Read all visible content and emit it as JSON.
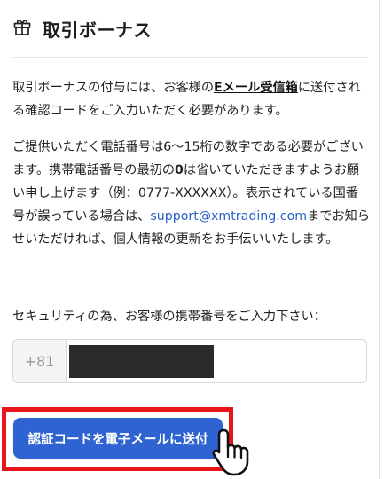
{
  "header": {
    "title": "取引ボーナス",
    "icon": "gift-icon"
  },
  "intro": {
    "text_before": "取引ボーナスの付与には、お客様の",
    "email_inbox": "Eメール受信箱",
    "text_after": "に送付される確認コードをご入力いただく必要があります。"
  },
  "notice": {
    "part1": "ご提供いただく電話番号は6～15桁の数字である必要がございます。携帯電話番号の最初の",
    "zero": "0",
    "part2": "は省いていただきますようお願い申し上げます（例：0777-XXXXXX）。表示されている国番号が誤っている場合は、",
    "support_email": "support@xmtrading.com",
    "part3": "までお知らせいただければ、個人情報の更新をお手伝いいたします。"
  },
  "phone": {
    "label": "セキュリティの為、お客様の携帯番号をご入力下さい：",
    "country_code": "+81",
    "value": ""
  },
  "cta": {
    "label": "認証コードを電子メールに送付"
  },
  "colors": {
    "accent": "#2f63d1",
    "link": "#2a62c9",
    "highlight": "#e8161b"
  }
}
